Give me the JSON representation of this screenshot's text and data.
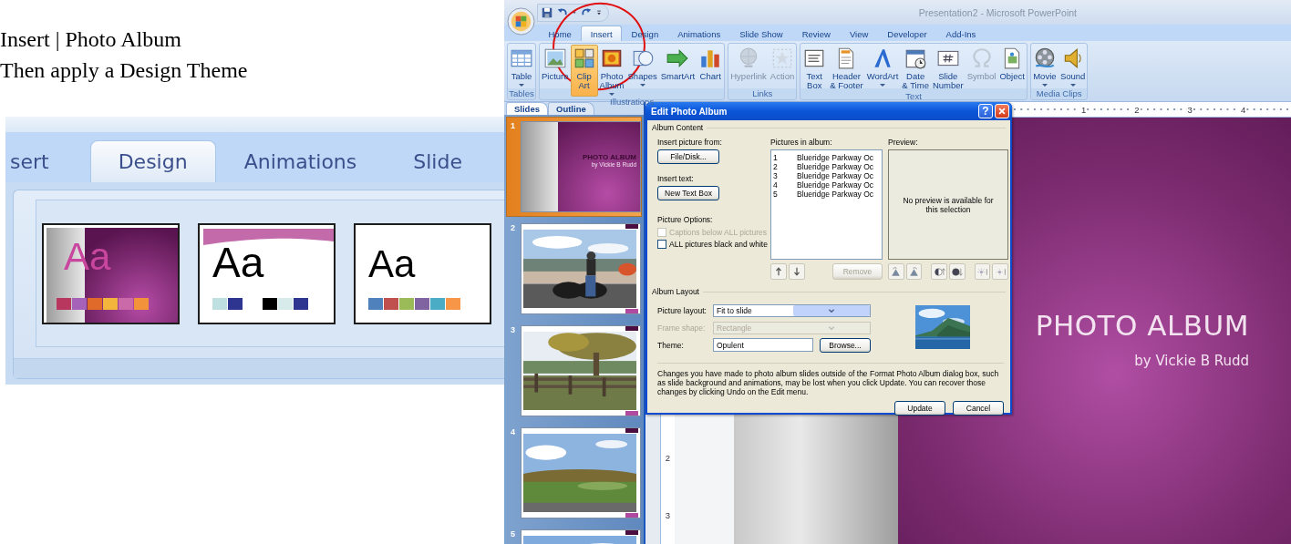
{
  "instructions": [
    "Insert | Photo Album",
    "Then apply a Design Theme"
  ],
  "design_ribbon": {
    "tabs": [
      {
        "label": "sert",
        "selected": false
      },
      {
        "label": "Design",
        "selected": true
      },
      {
        "label": "Animations",
        "selected": false
      },
      {
        "label": "Slide",
        "selected": false
      }
    ],
    "themes": [
      {
        "kind": "split",
        "sample": "Aa"
      },
      {
        "kind": "wave",
        "sample": "Aa"
      },
      {
        "kind": "plain",
        "sample": "Aa"
      }
    ]
  },
  "window": {
    "title": "Presentation2 - Microsoft PowerPoint",
    "tabs": [
      {
        "label": "Home",
        "selected": false
      },
      {
        "label": "Insert",
        "selected": true
      },
      {
        "label": "Design",
        "selected": false
      },
      {
        "label": "Animations",
        "selected": false
      },
      {
        "label": "Slide Show",
        "selected": false
      },
      {
        "label": "Review",
        "selected": false
      },
      {
        "label": "View",
        "selected": false
      },
      {
        "label": "Developer",
        "selected": false
      },
      {
        "label": "Add-Ins",
        "selected": false
      }
    ],
    "ribbon_groups": [
      {
        "label": "Tables",
        "buttons": [
          {
            "label": "Table",
            "dropdown": true,
            "disabled": false,
            "selected": false
          }
        ]
      },
      {
        "label": "Illustrations",
        "buttons": [
          {
            "label": "Picture",
            "dropdown": false,
            "disabled": false,
            "selected": false
          },
          {
            "label": "Clip\nArt",
            "dropdown": false,
            "disabled": false,
            "selected": true
          },
          {
            "label": "Photo\nAlbum",
            "dropdown": true,
            "disabled": false,
            "selected": false
          },
          {
            "label": "Shapes",
            "dropdown": true,
            "disabled": false,
            "selected": false
          },
          {
            "label": "SmartArt",
            "dropdown": false,
            "disabled": false,
            "selected": false
          },
          {
            "label": "Chart",
            "dropdown": false,
            "disabled": false,
            "selected": false
          }
        ]
      },
      {
        "label": "Links",
        "buttons": [
          {
            "label": "Hyperlink",
            "dropdown": false,
            "disabled": true,
            "selected": false
          },
          {
            "label": "Action",
            "dropdown": false,
            "disabled": true,
            "selected": false
          }
        ]
      },
      {
        "label": "Text",
        "buttons": [
          {
            "label": "Text\nBox",
            "dropdown": false,
            "disabled": false,
            "selected": false
          },
          {
            "label": "Header\n& Footer",
            "dropdown": false,
            "disabled": false,
            "selected": false
          },
          {
            "label": "WordArt",
            "dropdown": true,
            "disabled": false,
            "selected": false
          },
          {
            "label": "Date\n& Time",
            "dropdown": false,
            "disabled": false,
            "selected": false
          },
          {
            "label": "Slide\nNumber",
            "dropdown": false,
            "disabled": false,
            "selected": false
          },
          {
            "label": "Symbol",
            "dropdown": false,
            "disabled": true,
            "selected": false
          },
          {
            "label": "Object",
            "dropdown": false,
            "disabled": false,
            "selected": false
          }
        ]
      },
      {
        "label": "Media Clips",
        "buttons": [
          {
            "label": "Movie",
            "dropdown": true,
            "disabled": false,
            "selected": false
          },
          {
            "label": "Sound",
            "dropdown": true,
            "disabled": false,
            "selected": false
          }
        ]
      }
    ],
    "pane_tabs": [
      {
        "label": "Slides",
        "selected": true
      },
      {
        "label": "Outline",
        "selected": false
      }
    ],
    "slides": [
      {
        "number": "1",
        "selected": true,
        "kind": "title",
        "title": "PHOTO ALBUM",
        "subtitle": "by Vickie B Rudd"
      },
      {
        "number": "2",
        "selected": false,
        "kind": "picture"
      },
      {
        "number": "3",
        "selected": false,
        "kind": "picture"
      },
      {
        "number": "4",
        "selected": false,
        "kind": "picture"
      },
      {
        "number": "5",
        "selected": false,
        "kind": "picture"
      }
    ],
    "ruler": {
      "horizontal": [
        "1",
        "2",
        "3",
        "4"
      ],
      "vertical": [
        "2",
        "3"
      ]
    },
    "slide": {
      "title": "PHOTO ALBUM",
      "subtitle": "by Vickie B Rudd"
    }
  },
  "dialog": {
    "title": "Edit Photo Album",
    "help": "?",
    "content_label": "Album Content",
    "insert_picture_label": "Insert picture from:",
    "file_button": "File/Disk...",
    "insert_text_label": "Insert text:",
    "text_box_button": "New Text Box",
    "options_label": "Picture Options:",
    "options": [
      {
        "label": "Captions below ALL pictures",
        "checked": false,
        "disabled": true
      },
      {
        "label": "ALL pictures black and white",
        "checked": false,
        "disabled": false
      }
    ],
    "list_label": "Pictures in album:",
    "pictures": [
      {
        "number": "1",
        "name": "Blueridge Parkway Oc"
      },
      {
        "number": "2",
        "name": "Blueridge Parkway Oc"
      },
      {
        "number": "3",
        "name": "Blueridge Parkway Oc"
      },
      {
        "number": "4",
        "name": "Blueridge Parkway Oc"
      },
      {
        "number": "5",
        "name": "Blueridge Parkway Oc"
      }
    ],
    "remove": {
      "label": "Remove",
      "disabled": true
    },
    "preview_label": "Preview:",
    "preview_message": "No preview is available for this selection",
    "layout_label": "Album Layout",
    "picture_layout": {
      "label": "Picture layout:",
      "value": "Fit to slide",
      "disabled": false
    },
    "frame_shape": {
      "label": "Frame shape:",
      "value": "Rectangle",
      "disabled": true
    },
    "theme": {
      "label": "Theme:",
      "value": "Opulent"
    },
    "browse_button": "Browse...",
    "note": "Changes you have made to photo album slides outside of the Format Photo Album dialog box, such as slide background and animations, may be lost when you click Update. You can recover those changes by clicking Undo on the Edit menu.",
    "buttons": [
      "Update",
      "Cancel"
    ]
  }
}
